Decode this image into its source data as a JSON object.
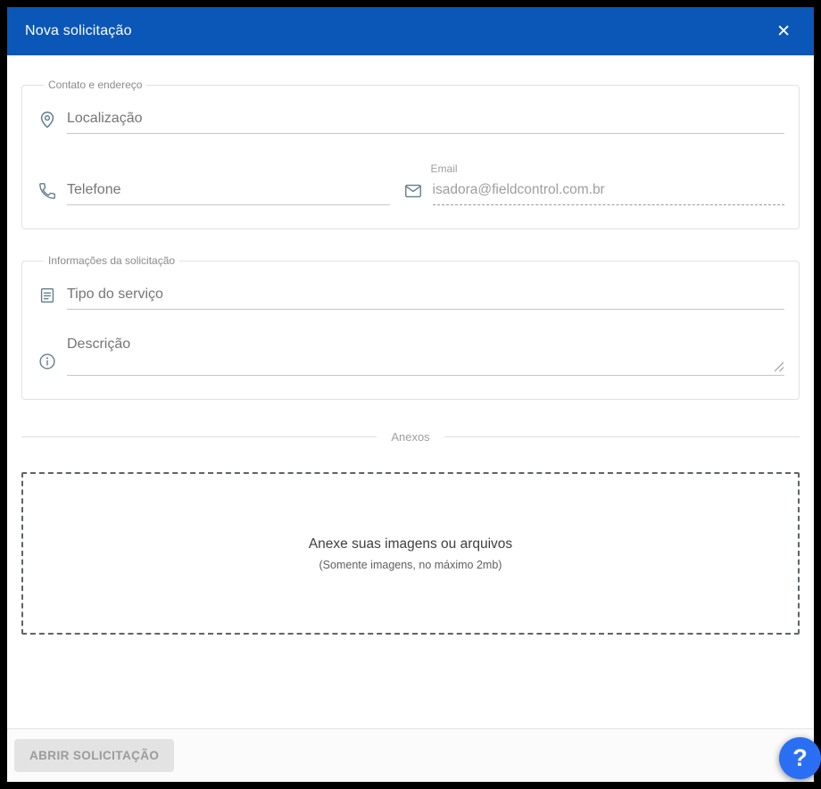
{
  "colors": {
    "header_bg": "#0a57b8",
    "help_bg": "#2a6ff3",
    "accent_gray": "#607d8b"
  },
  "header": {
    "title": "Nova solicitação",
    "close_icon": "✕"
  },
  "contact": {
    "legend": "Contato e endereço",
    "location_placeholder": "Localização",
    "phone_placeholder": "Telefone",
    "email_label": "Email",
    "email_value": "isadora@fieldcontrol.com.br"
  },
  "request_info": {
    "legend": "Informações da solicitação",
    "service_type_placeholder": "Tipo do serviço",
    "description_placeholder": "Descrição"
  },
  "attachments": {
    "divider_label": "Anexos",
    "dropzone_title": "Anexe suas imagens ou arquivos",
    "dropzone_subtitle": "(Somente imagens, no máximo 2mb)"
  },
  "footer": {
    "submit_label": "ABRIR SOLICITAÇÃO"
  },
  "help_button": {
    "label": "?"
  }
}
